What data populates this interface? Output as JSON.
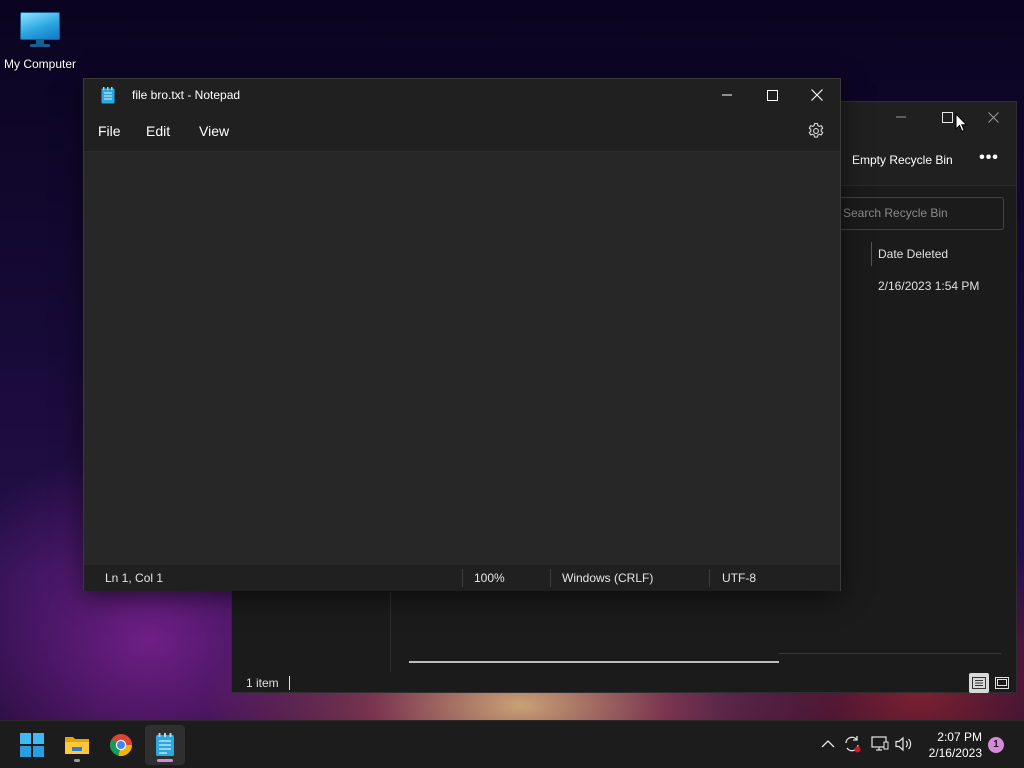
{
  "desktop": {
    "icons": [
      {
        "label": "My Computer",
        "icon": "monitor-icon"
      }
    ]
  },
  "notepad": {
    "title": "file bro.txt - Notepad",
    "menu": {
      "file": "File",
      "edit": "Edit",
      "view": "View"
    },
    "content": "",
    "status": {
      "position": "Ln 1, Col 1",
      "zoom": "100%",
      "line_ending": "Windows (CRLF)",
      "encoding": "UTF-8"
    }
  },
  "recycle_bin": {
    "toolbar": {
      "empty_label": "Empty Recycle Bin",
      "more_label": "•••"
    },
    "search": {
      "placeholder": "Search Recycle Bin"
    },
    "columns": [
      "Date Deleted"
    ],
    "rows": [
      {
        "date_deleted": "2/16/2023 1:54 PM"
      }
    ],
    "status": {
      "count": "1 item"
    }
  },
  "taskbar": {
    "apps": [
      {
        "name": "start",
        "icon": "windows-logo-icon"
      },
      {
        "name": "file-explorer",
        "icon": "folder-icon",
        "running": true
      },
      {
        "name": "chrome",
        "icon": "chrome-icon"
      },
      {
        "name": "notepad",
        "icon": "notepad-icon",
        "active": true
      }
    ],
    "tray": {
      "icons": [
        "chevron-up-icon",
        "sync-icon",
        "network-icon",
        "volume-icon"
      ]
    },
    "clock": {
      "time": "2:07 PM",
      "date": "2/16/2023"
    },
    "notifications": "1"
  },
  "colors": {
    "accent": "#4cc2ff",
    "window_bg": "#272727",
    "titlebar_bg": "#202020",
    "taskbar_bg": "#1c1c1c",
    "notification_badge": "#d48ad8"
  }
}
